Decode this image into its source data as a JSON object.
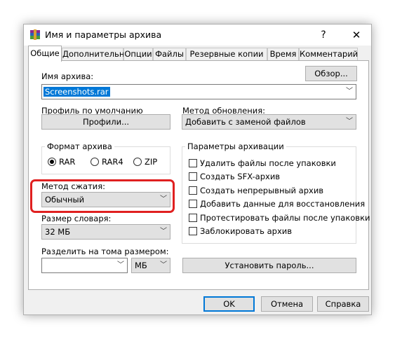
{
  "window": {
    "title": "Имя и параметры архива",
    "help": "?",
    "close": "✕"
  },
  "tabs": [
    "Общие",
    "Дополнительно",
    "Опции",
    "Файлы",
    "Резервные копии",
    "Время",
    "Комментарий"
  ],
  "archive_name": {
    "label": "Имя архива:",
    "value": "Screenshots.rar",
    "browse": "Обзор..."
  },
  "profile": {
    "label": "Профиль по умолчанию",
    "button": "Профили..."
  },
  "update_method": {
    "label": "Метод обновления:",
    "value": "Добавить с заменой файлов"
  },
  "format": {
    "title": "Формат архива",
    "options": [
      "RAR",
      "RAR4",
      "ZIP"
    ],
    "selected": "RAR"
  },
  "options": {
    "title": "Параметры архивации",
    "items": [
      "Удалить файлы после упаковки",
      "Создать SFX-архив",
      "Создать непрерывный архив",
      "Добавить данные для восстановления",
      "Протестировать файлы после упаковки",
      "Заблокировать архив"
    ]
  },
  "compression": {
    "label": "Метод сжатия:",
    "value": "Обычный"
  },
  "dictionary": {
    "label": "Размер словаря:",
    "value": "32 МБ"
  },
  "split": {
    "label": "Разделить на тома размером:",
    "value": "",
    "unit": "МБ"
  },
  "password_button": "Установить пароль...",
  "footer": {
    "ok": "OK",
    "cancel": "Отмена",
    "help": "Справка"
  },
  "colors": {
    "accent": "#0078d7",
    "highlight": "#e02020"
  }
}
